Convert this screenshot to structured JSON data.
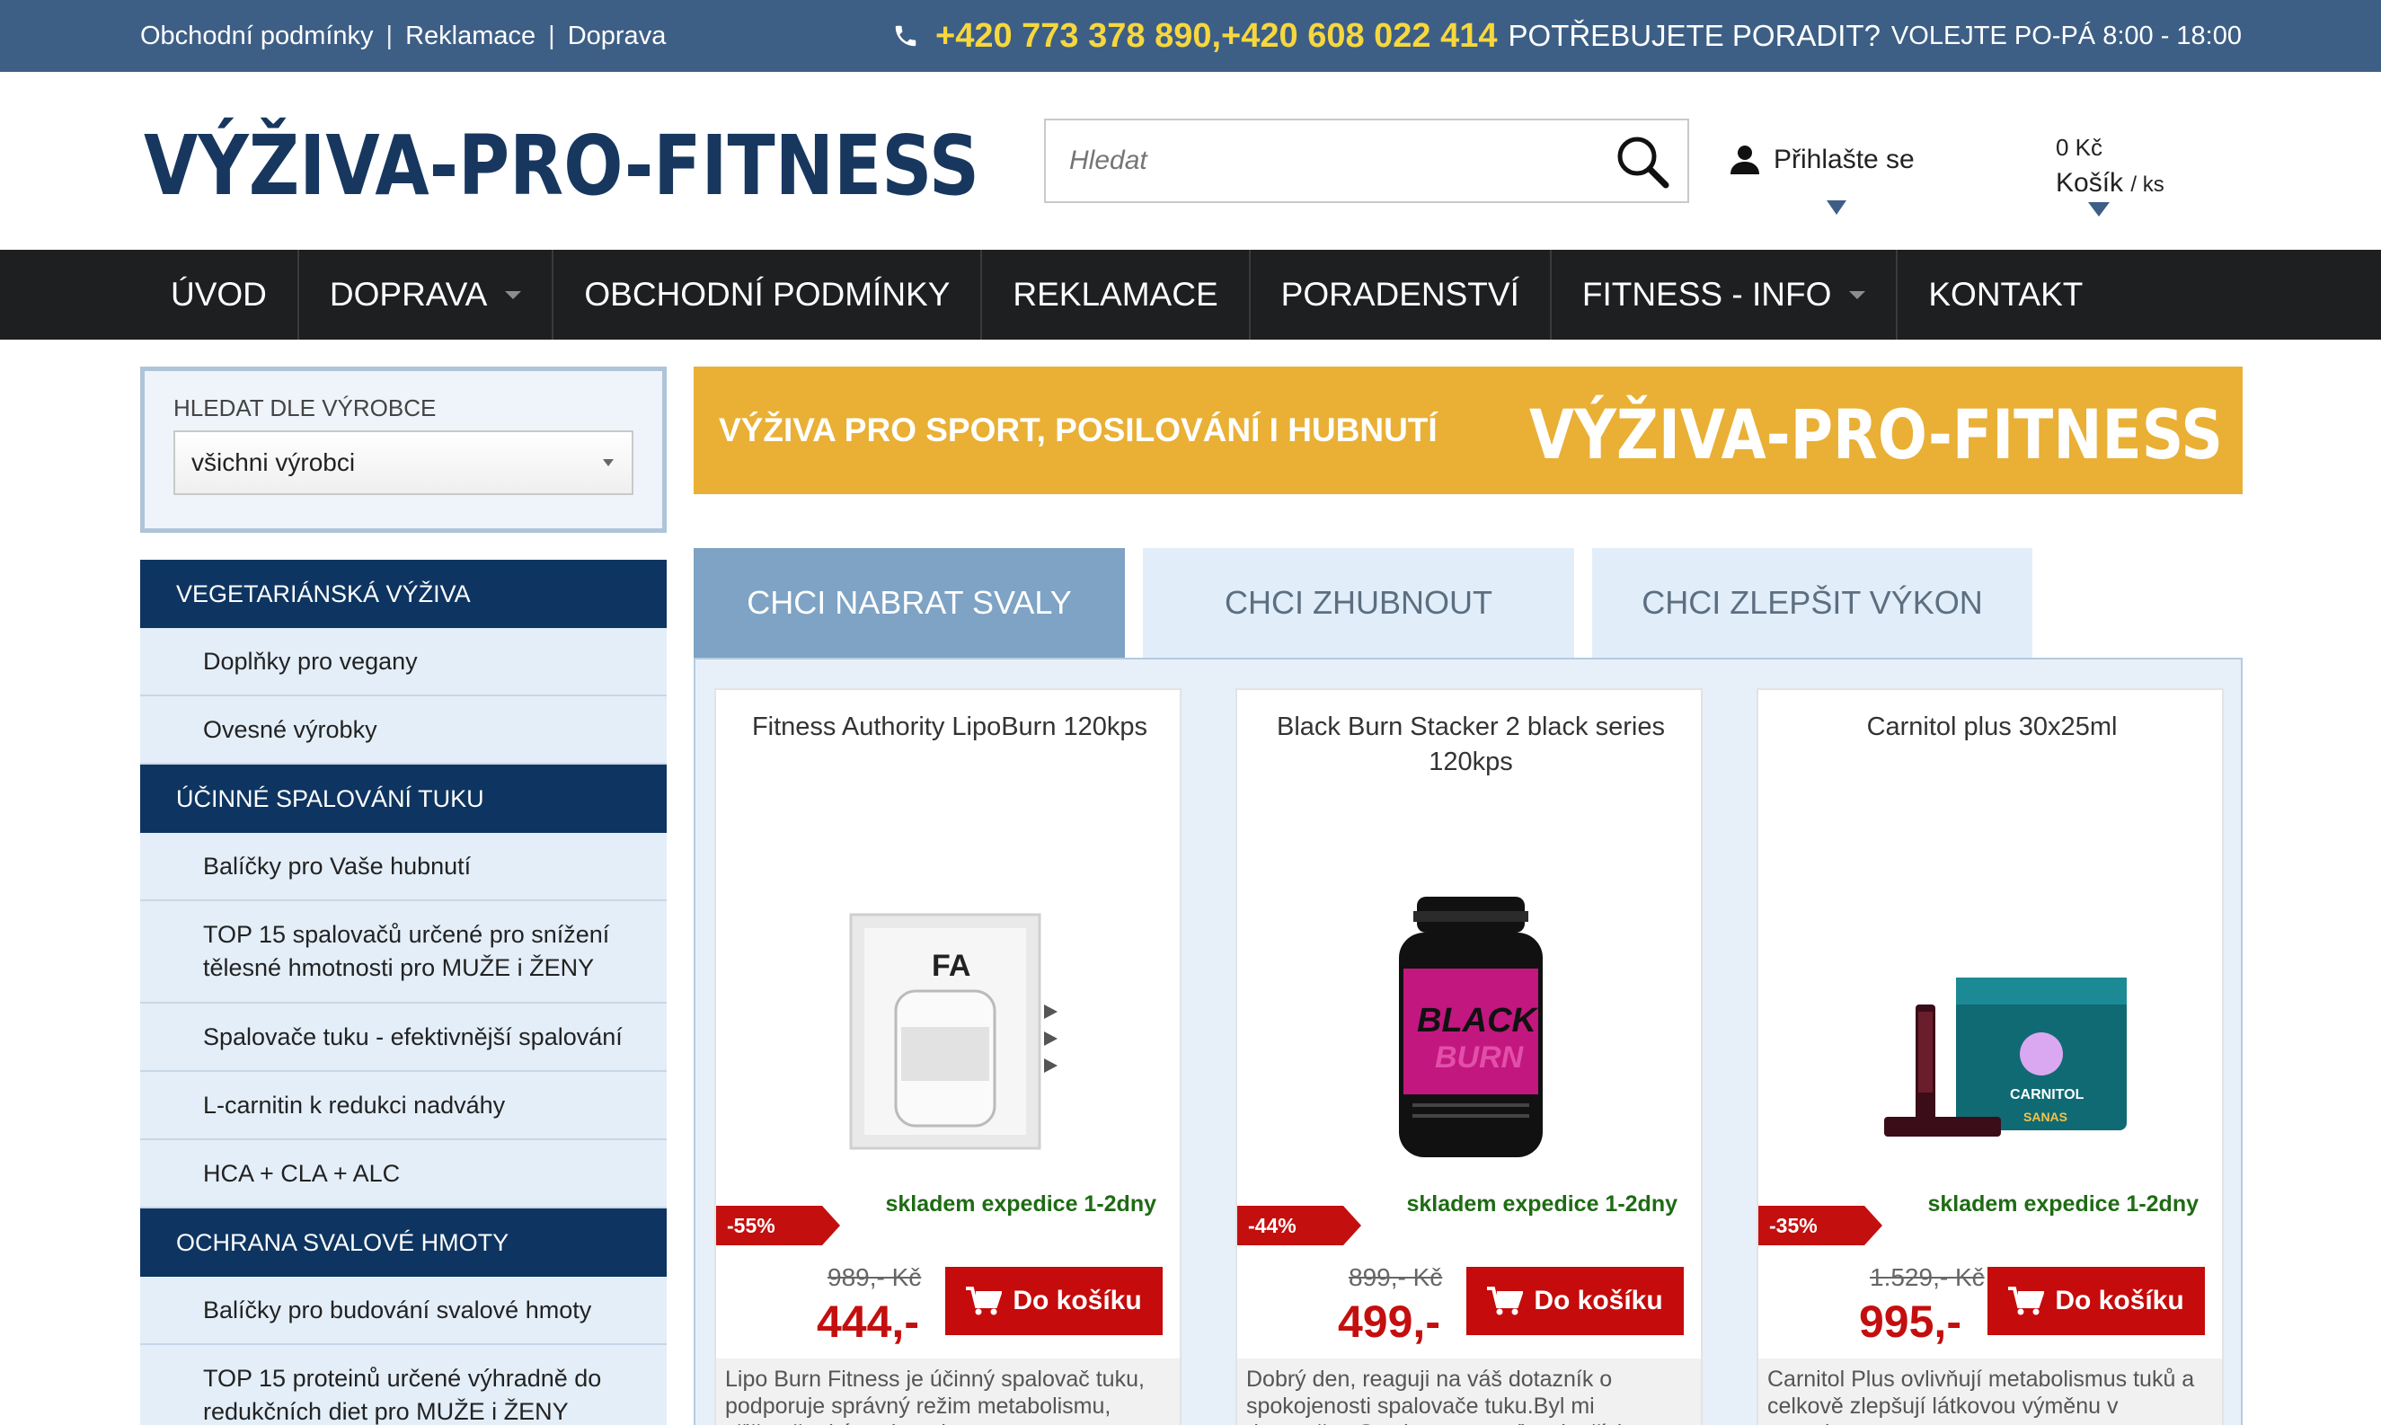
{
  "topbar": {
    "links": [
      "Obchodní podmínky",
      "Reklamace",
      "Doprava"
    ],
    "separator": "|",
    "phone": "+420 773 378 890,+420 608 022 414",
    "help": "POTŘEBUJETE PORADIT?",
    "hours": "VOLEJTE PO-PÁ 8:00 - 18:00"
  },
  "header": {
    "logo_text": "VÝŽIVA-PRO-FITNESS",
    "search_placeholder": "Hledat",
    "login_label": "Přihlašte se",
    "cart_amount": "0 Kč",
    "cart_label": "Košík",
    "cart_unit": "/ ks"
  },
  "nav": {
    "items": [
      {
        "label": "ÚVOD"
      },
      {
        "label": "DOPRAVA"
      },
      {
        "label": "OBCHODNÍ PODMÍNKY"
      },
      {
        "label": "REKLAMACE"
      },
      {
        "label": "PORADENSTVÍ"
      },
      {
        "label": "FITNESS - INFO"
      },
      {
        "label": "KONTAKT"
      }
    ]
  },
  "filter": {
    "title": "HLEDAT DLE VÝROBCE",
    "selected": "všichni výrobci"
  },
  "sidebar": {
    "cat1": {
      "title": "VEGETARIÁNSKÁ VÝŽIVA",
      "items": [
        "Doplňky pro vegany",
        "Ovesné výrobky"
      ]
    },
    "cat2": {
      "title": "ÚČINNÉ SPALOVÁNÍ TUKU",
      "items": [
        "Balíčky pro Vaše hubnutí",
        "TOP 15 spalovačů určené pro snížení tělesné hmotnosti pro MUŽE i ŽENY",
        "Spalovače tuku - efektivnější spalování",
        "L-carnitin k redukci nadváhy",
        "HCA + CLA + ALC"
      ]
    },
    "cat3": {
      "title": "OCHRANA SVALOVÉ HMOTY",
      "items": [
        "Balíčky pro budování svalové hmoty",
        "TOP 15 proteinů určené výhradně do redukčních diet pro MUŽE i ŽENY"
      ]
    }
  },
  "banner": {
    "text": "VÝŽIVA PRO SPORT, POSILOVÁNÍ I HUBNUTÍ",
    "logo_text": "VÝŽIVA-PRO-FITNESS"
  },
  "tabs": [
    "CHCI NABRAT SVALY",
    "CHCI ZHUBNOUT",
    "CHCI ZLEPŠIT VÝKON"
  ],
  "products": [
    {
      "name": "Fitness Authority LipoBurn 120kps",
      "discount": "-55%",
      "stock": "skladem expedice 1-2dny",
      "old_price": "989,- Kč",
      "price": "444,-",
      "buy_label": "Do košíku",
      "desc": "Lipo Burn Fitness je účinný spalovač tuku, podporuje správný režim metabolismu, přičemž také podporuje..."
    },
    {
      "name": "Black Burn Stacker 2 black series 120kps",
      "discount": "-44%",
      "stock": "skladem expedice 1-2dny",
      "old_price": "899,- Kč",
      "price": "499,-",
      "buy_label": "Do košíku",
      "desc": "Dobrý den, reaguji na váš dotazník o spokojenosti spalovače tuku.Byl mi doporučen Stackerem a teď mohu říci..."
    },
    {
      "name": "Carnitol plus 30x25ml",
      "discount": "-35%",
      "stock": "skladem expedice 1-2dny",
      "old_price": "1.529,- Kč",
      "price": "995,-",
      "buy_label": "Do košíku",
      "desc": "Carnitol Plus ovlivňují metabolismus tuků a celkově zlepšují látkovou výměnu v organismu..."
    }
  ],
  "colors": {
    "topbar": "#3d5f86",
    "phone": "#f7d73d",
    "nav": "#1d1f21",
    "category": "#0e3561",
    "banner": "#e9b035",
    "buy": "#c50b0b",
    "price": "#c40f0f",
    "stock": "#1e6b14"
  }
}
